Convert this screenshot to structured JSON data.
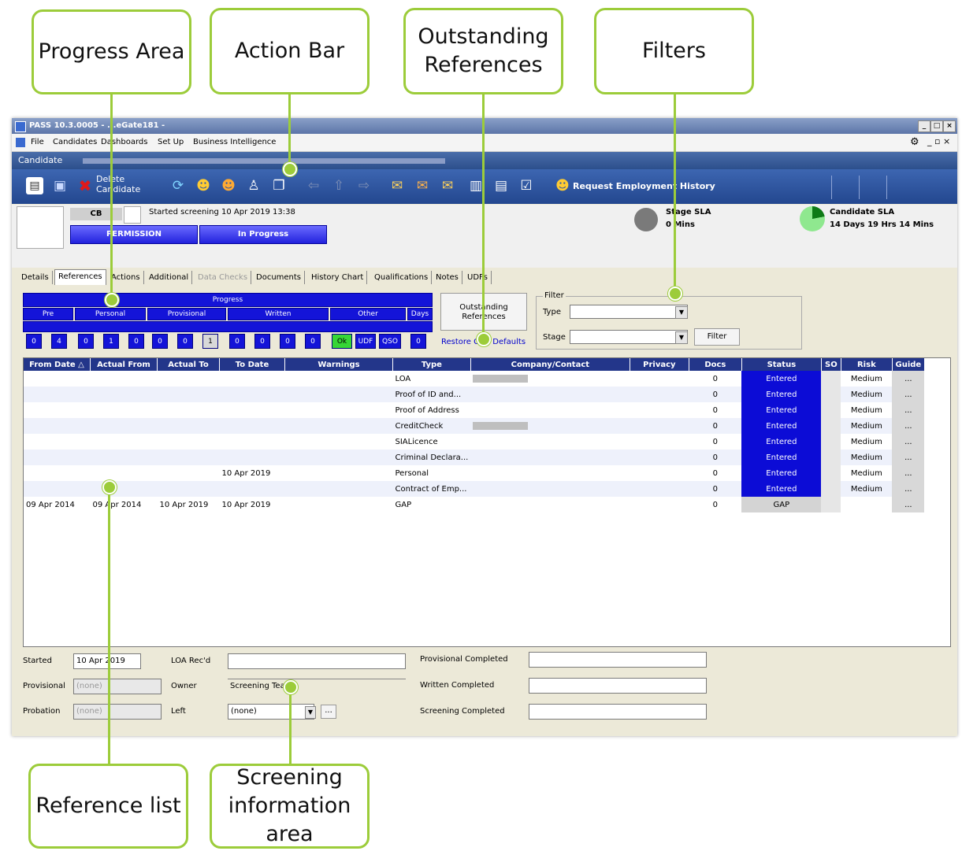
{
  "callouts": {
    "progress_area": "Progress Area",
    "action_bar": "Action Bar",
    "outstanding_references": "Outstanding References",
    "filters": "Filters",
    "reference_list": "Reference list",
    "screening_information_area": "Screening information area"
  },
  "window": {
    "title": "PASS 10.3.0005 - ...eGate181 -",
    "menu": [
      "File",
      "Candidates",
      "Dashboards",
      "Set Up",
      "Business Intelligence"
    ],
    "candidate_label": "Candidate"
  },
  "toolbar": {
    "delete_candidate_label": "Delete Candidate",
    "request_employment_history_label": "Request Employment History"
  },
  "header": {
    "initials": "CB",
    "started_screening": "Started screening 10 Apr 2019 13:38",
    "permission_label": "PERMISSION",
    "in_progress_label": "In Progress",
    "stage_sla_label": "Stage SLA",
    "stage_sla_value": "0 Mins",
    "candidate_sla_label": "Candidate SLA",
    "candidate_sla_value": "14 Days 19 Hrs 14 Mins"
  },
  "tabs": [
    "Details",
    "References",
    "Actions",
    "Additional",
    "Data Checks",
    "Documents",
    "History Chart",
    "Qualifications",
    "Notes",
    "UDFs"
  ],
  "progress": {
    "title": "Progress",
    "groups": [
      "Pre",
      "Personal",
      "Provisional",
      "Written",
      "Other",
      "Days"
    ],
    "values": [
      "0",
      "4",
      "0",
      "1",
      "0",
      "0",
      "0",
      "1",
      "0",
      "0",
      "0",
      "0",
      "Ok",
      "UDF",
      "QSO",
      "0"
    ]
  },
  "outstanding_references_button": "Outstanding References",
  "restore_grid_defaults": "Restore Grid Defaults",
  "filter": {
    "legend": "Filter",
    "type_label": "Type",
    "stage_label": "Stage",
    "filter_button": "Filter"
  },
  "grid": {
    "columns": [
      "From Date △",
      "Actual From",
      "Actual To",
      "To Date",
      "Warnings",
      "Type",
      "Company/Contact",
      "Privacy",
      "Docs",
      "Status",
      "SO",
      "Risk",
      "Guide"
    ],
    "rows": [
      [
        "",
        "",
        "",
        "",
        "",
        "LOA",
        "",
        "",
        "0",
        "Entered",
        "",
        "Medium",
        "..."
      ],
      [
        "",
        "",
        "",
        "",
        "",
        "Proof of ID and...",
        "",
        "",
        "0",
        "Entered",
        "",
        "Medium",
        "..."
      ],
      [
        "",
        "",
        "",
        "",
        "",
        "Proof of Address",
        "",
        "",
        "0",
        "Entered",
        "",
        "Medium",
        "..."
      ],
      [
        "",
        "",
        "",
        "",
        "",
        "CreditCheck",
        "",
        "",
        "0",
        "Entered",
        "",
        "Medium",
        "..."
      ],
      [
        "",
        "",
        "",
        "",
        "",
        "SIALicence",
        "",
        "",
        "0",
        "Entered",
        "",
        "Medium",
        "..."
      ],
      [
        "",
        "",
        "",
        "",
        "",
        "Criminal Declara...",
        "",
        "",
        "0",
        "Entered",
        "",
        "Medium",
        "..."
      ],
      [
        "",
        "",
        "",
        "10 Apr 2019",
        "",
        "Personal",
        "",
        "",
        "0",
        "Entered",
        "",
        "Medium",
        "..."
      ],
      [
        "",
        "",
        "",
        "",
        "",
        "Contract of Emp...",
        "",
        "",
        "0",
        "Entered",
        "",
        "Medium",
        "..."
      ],
      [
        "09 Apr 2014",
        "09 Apr 2014",
        "10 Apr 2019",
        "10 Apr 2019",
        "",
        "GAP",
        "",
        "",
        "0",
        "GAP",
        "",
        "",
        "..."
      ]
    ]
  },
  "screening": {
    "started_label": "Started",
    "started_value": "10 Apr 2019",
    "provisional_label": "Provisional",
    "provisional_value": "(none)",
    "probation_label": "Probation",
    "probation_value": "(none)",
    "loa_recd_label": "LOA Rec'd",
    "owner_label": "Owner",
    "owner_value": "Screening Team",
    "left_label": "Left",
    "left_value": "(none)",
    "provisional_completed_label": "Provisional Completed",
    "written_completed_label": "Written Completed",
    "screening_completed_label": "Screening Completed"
  },
  "colors": {
    "callout_border": "#9ccc3a",
    "status_blue": "#0c0cd6",
    "ok_green": "#36d636",
    "toolbar_blue": "#23478f"
  }
}
